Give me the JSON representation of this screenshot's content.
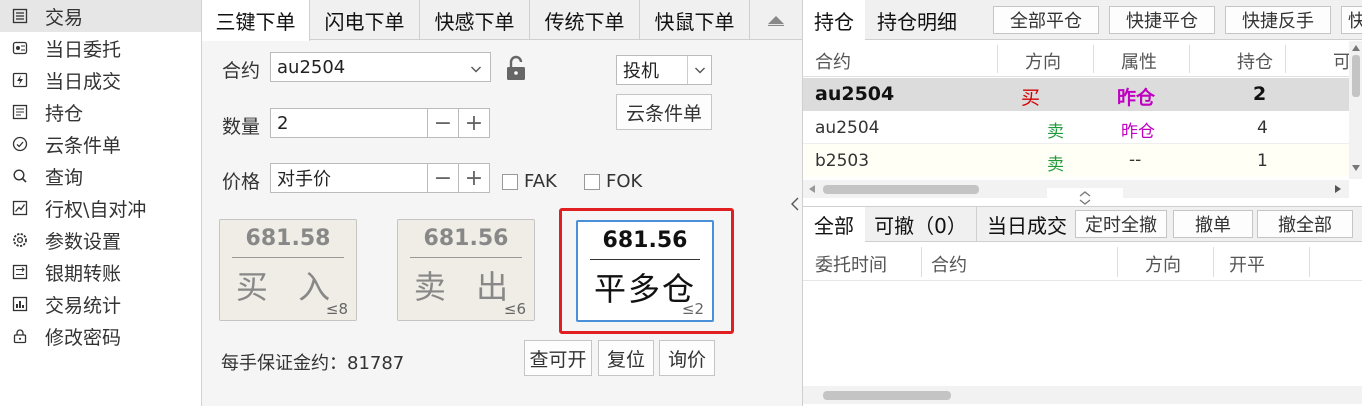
{
  "sidebar": {
    "items": [
      {
        "label": "交易",
        "icon": "list-icon"
      },
      {
        "label": "当日委托",
        "icon": "orders-icon"
      },
      {
        "label": "当日成交",
        "icon": "deal-icon"
      },
      {
        "label": "持仓",
        "icon": "position-icon"
      },
      {
        "label": "云条件单",
        "icon": "cloud-condition-icon"
      },
      {
        "label": "查询",
        "icon": "search-icon"
      },
      {
        "label": "行权\\自对冲",
        "icon": "chart-icon"
      },
      {
        "label": "参数设置",
        "icon": "gear-icon"
      },
      {
        "label": "银期转账",
        "icon": "transfer-icon"
      },
      {
        "label": "交易统计",
        "icon": "stats-icon"
      },
      {
        "label": "修改密码",
        "icon": "lock-icon"
      }
    ]
  },
  "order_tabs": [
    "三键下单",
    "闪电下单",
    "快感下单",
    "传统下单",
    "快鼠下单"
  ],
  "order": {
    "contract_label": "合约",
    "contract_value": "au2504",
    "quantity_label": "数量",
    "quantity_value": "2",
    "price_label": "价格",
    "price_value": "对手价",
    "fak_label": "FAK",
    "fok_label": "FOK",
    "hedge_value": "投机",
    "cloud_button": "云条件单",
    "buy": {
      "price": "681.58",
      "label": "买 入",
      "limit": "≤8"
    },
    "sell": {
      "price": "681.56",
      "label": "卖 出",
      "limit": "≤6"
    },
    "close": {
      "price": "681.56",
      "label": "平多仓",
      "limit": "≤2"
    },
    "margin_text": "每手保证金约：81787",
    "btn_query_open": "查可开",
    "btn_reset": "复位",
    "btn_inquiry": "询价"
  },
  "positions": {
    "tab_active": "持仓",
    "tab_detail": "持仓明细",
    "actions": [
      "全部平仓",
      "快捷平仓",
      "快捷反手",
      "快"
    ],
    "headers": [
      "合约",
      "方向",
      "属性",
      "持仓",
      "可"
    ],
    "rows": [
      {
        "contract": "au2504",
        "direction": "买",
        "attr": "昨仓",
        "qty": "2"
      },
      {
        "contract": "au2504",
        "direction": "卖",
        "attr": "昨仓",
        "qty": "4"
      },
      {
        "contract": "b2503",
        "direction": "卖",
        "attr": "--",
        "qty": "1"
      }
    ]
  },
  "entrust": {
    "tabs": [
      "全部",
      "可撤（0）",
      "当日成交"
    ],
    "actions": [
      "定时全撤",
      "撤单",
      "撤全部"
    ],
    "headers": [
      "委托时间",
      "合约",
      "方向",
      "开平"
    ]
  },
  "colors": {
    "buy": "#d40000",
    "sell": "#1f9a3a",
    "attr": "#c000c0",
    "highlight": "#e02020"
  }
}
